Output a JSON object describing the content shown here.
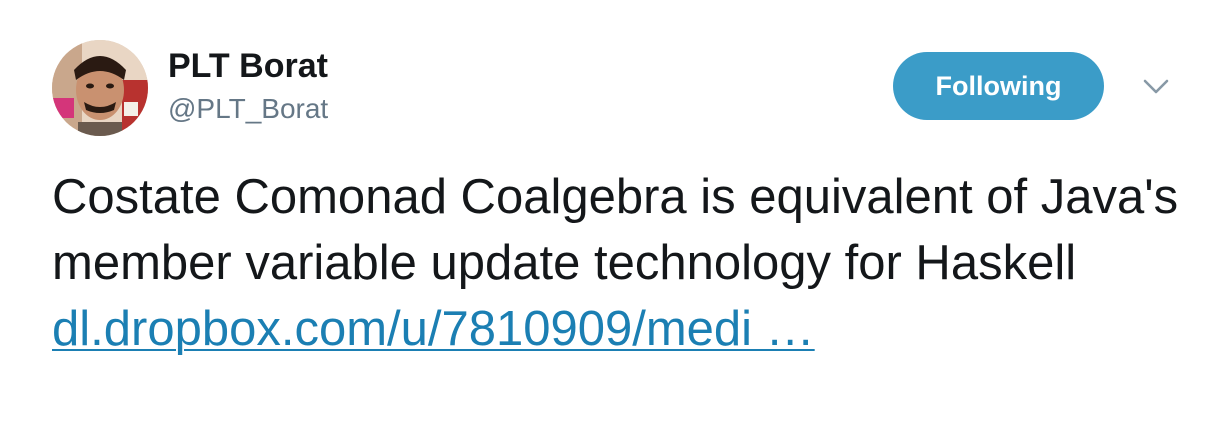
{
  "author": {
    "display_name": "PLT Borat",
    "handle": "@PLT_Borat"
  },
  "follow_button": {
    "label": "Following"
  },
  "menu": {
    "icon": "chevron-down-icon"
  },
  "tweet": {
    "text_before_link": "Costate Comonad Coalgebra is equivalent of Java's member variable update technology for Haskell ",
    "link_text": "dl.dropbox.com/u/7810909/medi …"
  },
  "colors": {
    "follow_button_bg": "#3b9cc8",
    "link": "#1b7fb3",
    "handle": "#657786",
    "text": "#14171a"
  }
}
